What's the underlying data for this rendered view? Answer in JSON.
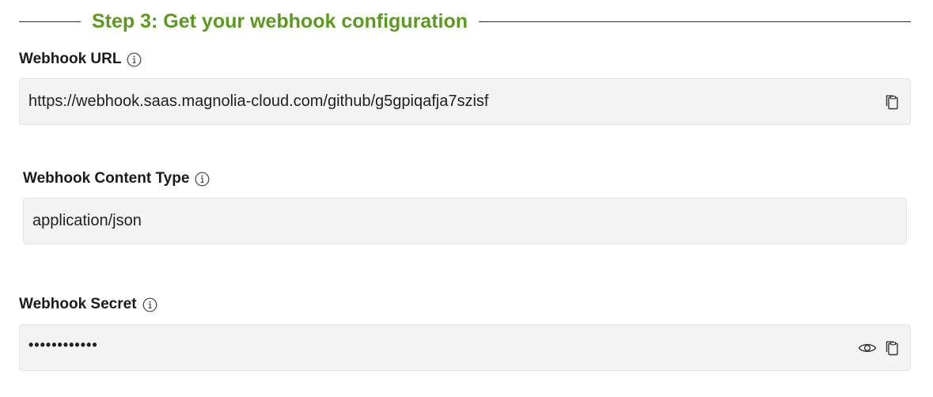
{
  "step": {
    "title": "Step 3: Get your webhook configuration"
  },
  "fields": {
    "url": {
      "label": "Webhook URL",
      "value": "https://webhook.saas.magnolia-cloud.com/github/g5gpiqafja7szisf"
    },
    "content_type": {
      "label": "Webhook Content Type",
      "value": "application/json"
    },
    "secret": {
      "label": "Webhook Secret",
      "value": "••••••••••••"
    }
  },
  "icons": {
    "info": "info-icon",
    "copy": "copy-icon",
    "reveal": "eye-icon"
  },
  "colors": {
    "step_title": "#5a9a1f",
    "field_background": "#f3f3f3"
  }
}
